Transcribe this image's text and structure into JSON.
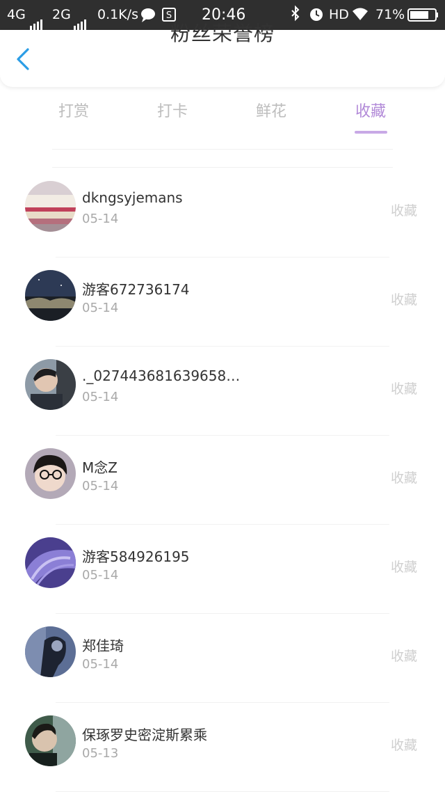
{
  "status_bar": {
    "network1": "4G",
    "network2": "2G",
    "speed": "0.1K/s",
    "time": "20:46",
    "hd": "HD",
    "battery": "71%"
  },
  "header": {
    "title": "粉丝荣誉榜"
  },
  "tabs": [
    {
      "label": "打赏"
    },
    {
      "label": "打卡"
    },
    {
      "label": "鲜花"
    },
    {
      "label": "收藏"
    }
  ],
  "active_tab": "收藏",
  "list": [
    {
      "name": "dkngsyjemans",
      "date": "05-14",
      "action": "收藏"
    },
    {
      "name": "游客672736174",
      "date": "05-14",
      "action": "收藏"
    },
    {
      "name": "._027443681639658…",
      "date": "05-14",
      "action": "收藏"
    },
    {
      "name": "M念Z",
      "date": "05-14",
      "action": "收藏"
    },
    {
      "name": "游客584926195",
      "date": "05-14",
      "action": "收藏"
    },
    {
      "name": "郑佳琦",
      "date": "05-14",
      "action": "收藏"
    },
    {
      "name": "保琢罗史密淀斯累乘",
      "date": "05-13",
      "action": "收藏"
    }
  ],
  "colors": {
    "accent": "#b28ad8",
    "status_bar_bg": "#2f2f2f",
    "back_arrow": "#2b9de6",
    "inactive_text": "#bdbdbd"
  },
  "icons": [
    "back-arrow-icon",
    "message-icon",
    "s-box-icon",
    "bluetooth-icon",
    "alarm-icon",
    "wifi-icon",
    "battery-icon",
    "signal-icon"
  ]
}
